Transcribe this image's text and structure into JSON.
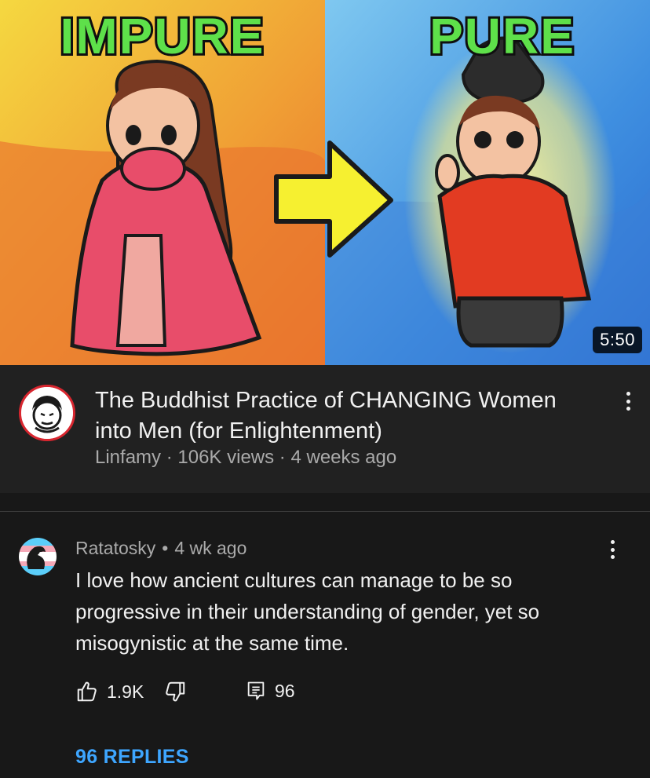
{
  "thumbnail": {
    "left_label": "IMPURE",
    "right_label": "PURE",
    "duration": "5:50"
  },
  "video": {
    "title": "The Buddhist Practice of CHANGING Women into Men (for Enlightenment)",
    "channel": "Linfamy",
    "views": "106K views",
    "age": "4 weeks ago",
    "separator": "·"
  },
  "comment": {
    "author": "Ratatosky",
    "separator": "•",
    "time": "4 wk ago",
    "text": "I love how ancient cultures can manage to be so progressive in their understanding of gender, yet so misogynistic at the same time.",
    "likes": "1.9K",
    "reply_count": "96",
    "replies_link": "96 REPLIES"
  },
  "icons": {
    "like": "thumbs-up-icon",
    "dislike": "thumbs-down-icon",
    "reply": "comment-icon",
    "more": "more-vertical-icon"
  },
  "colors": {
    "background": "#181818",
    "info_background": "#212121",
    "link": "#3ea6ff",
    "secondary_text": "#aaaaaa",
    "title_green": "#5ee04a"
  }
}
